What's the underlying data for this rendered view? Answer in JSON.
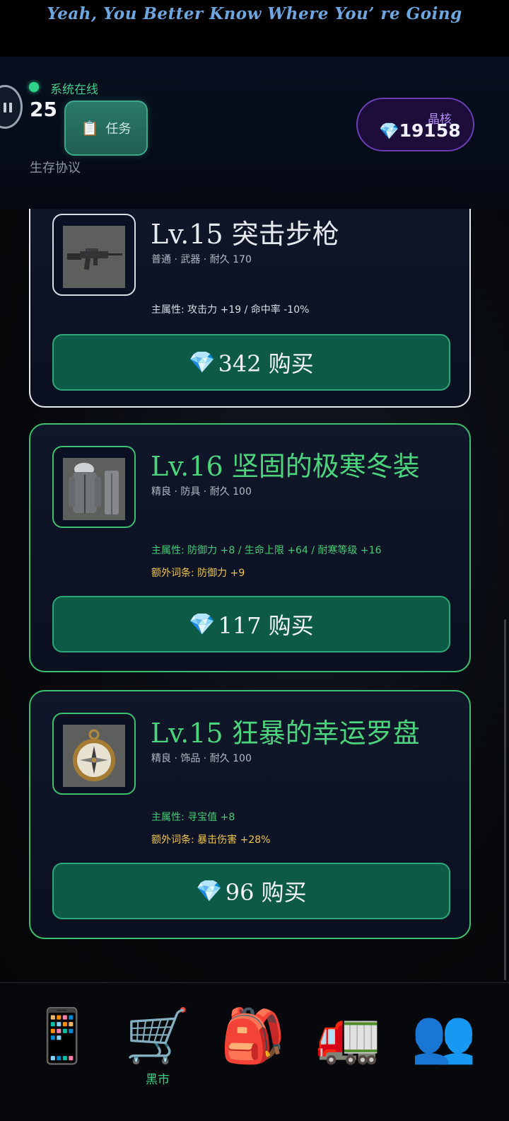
{
  "banner": {
    "text": "Yeah, You Better Know Where You’ re Going"
  },
  "header": {
    "status": "系统在线",
    "level": "25",
    "protocol": "生存协议",
    "task_button": {
      "icon": "clipboard-icon",
      "label": "任务"
    },
    "crystal": {
      "label": "晶核",
      "icon": "gem-icon",
      "value": "19158"
    },
    "colors": {
      "online": "#2fd38a",
      "crystal_accent": "#b68cf3"
    }
  },
  "items": [
    {
      "rarity": "common",
      "title": "Lv.15 突击步枪",
      "meta": "普通 · 武器 · 耐久 170",
      "image": "assault-rifle",
      "main_attr": "主属性: 攻击力 +19 / 命中率 -10%",
      "extra_attr": "",
      "price": "342 购买"
    },
    {
      "rarity": "fine",
      "title": "Lv.16 坚固的极寒冬装",
      "meta": "精良 · 防具 · 耐久 100",
      "image": "winter-coat",
      "main_attr": "主属性: 防御力 +8 / 生命上限 +64 / 耐寒等级 +16",
      "extra_attr": "额外词条: 防御力 +9",
      "price": "117 购买"
    },
    {
      "rarity": "fine",
      "title": "Lv.15 狂暴的幸运罗盘",
      "meta": "精良 · 饰品 · 耐久 100",
      "image": "compass",
      "main_attr": "主属性: 寻宝值 +8",
      "extra_attr": "额外词条: 暴击伤害 +28%",
      "price": "96 购买"
    }
  ],
  "nav": {
    "items": [
      {
        "icon": "phone-icon",
        "label": ""
      },
      {
        "icon": "shopping-cart-icon",
        "label": "黑市",
        "active": true
      },
      {
        "icon": "backpack-icon",
        "label": ""
      },
      {
        "icon": "truck-icon",
        "label": ""
      },
      {
        "icon": "people-icon",
        "label": ""
      }
    ],
    "active_color": "#3fcf8c"
  },
  "colors": {
    "common_border": "#e7ebf1",
    "fine_border": "#3cbf6e",
    "buy_button": "#0d5a46",
    "extra_attr": "#f0c54a"
  }
}
